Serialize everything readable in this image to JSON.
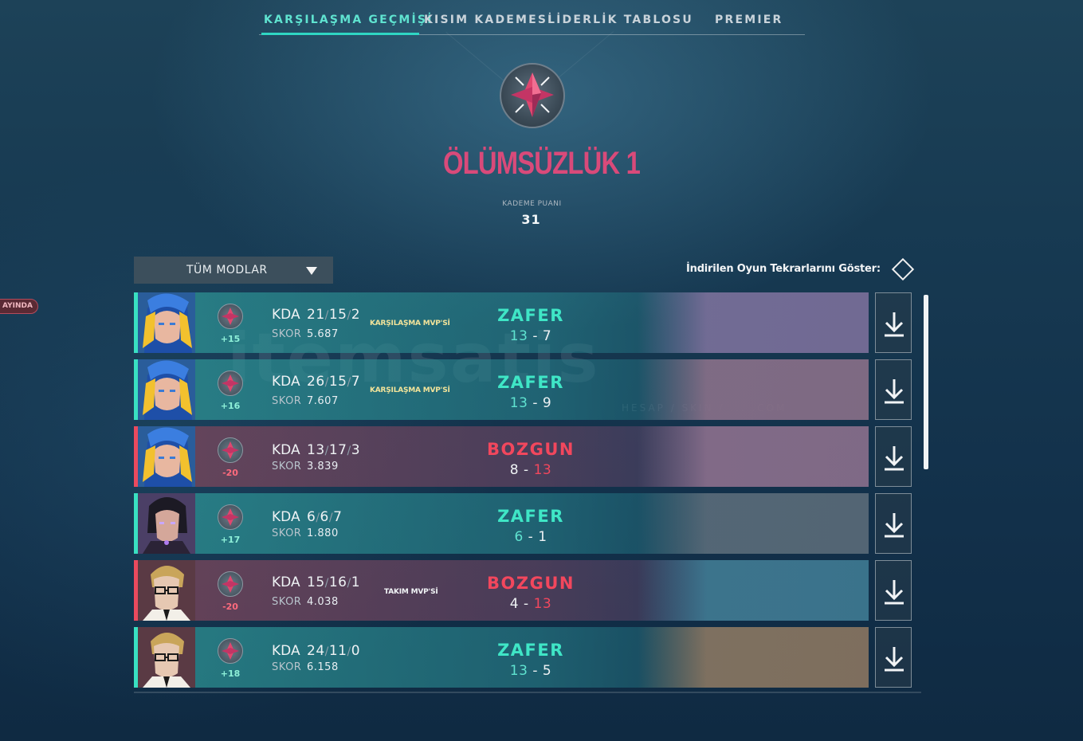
{
  "nav": {
    "tabs": [
      {
        "label": "KARŞILAŞMA GEÇMİŞİ",
        "active": true
      },
      {
        "label": "KISIM KADEMESİ",
        "active": false
      },
      {
        "label": "LİDERLİK TABLOSU",
        "active": false
      },
      {
        "label": "PREMIER",
        "active": false
      }
    ]
  },
  "rank": {
    "name": "ÖLÜMSÜZLÜK 1",
    "points_label": "KADEME PUANI",
    "points_value": "31",
    "color": "#d94a7a"
  },
  "live_badge": "AYINDA",
  "filter": {
    "mode_label": "TÜM MODLAR",
    "replay_label": "İndirilen Oyun Tekrarlarını Göster:"
  },
  "watermark": {
    "text": "itemsatis",
    "sub": "HESAP / SKIN / ... .COM"
  },
  "matches": [
    {
      "outcome": "win",
      "agent": "neon",
      "rr": "+15",
      "kda_label": "KDA",
      "kills": "21",
      "deaths": "15",
      "assists": "2",
      "score_label": "SKOR",
      "score": "5.687",
      "mvp": "KARŞILAŞMA MVP'Sİ",
      "mvp_type": "match",
      "result": "ZAFER",
      "team_score": "13",
      "enemy_score": "7",
      "map_color": "#7b6f9a"
    },
    {
      "outcome": "win",
      "agent": "neon",
      "rr": "+16",
      "kda_label": "KDA",
      "kills": "26",
      "deaths": "15",
      "assists": "7",
      "score_label": "SKOR",
      "score": "7.607",
      "mvp": "KARŞILAŞMA MVP'Sİ",
      "mvp_type": "match",
      "result": "ZAFER",
      "team_score": "13",
      "enemy_score": "9",
      "map_color": "#8a6f88"
    },
    {
      "outcome": "loss",
      "agent": "neon",
      "rr": "-20",
      "kda_label": "KDA",
      "kills": "13",
      "deaths": "17",
      "assists": "3",
      "score_label": "SKOR",
      "score": "3.839",
      "mvp": "",
      "mvp_type": "",
      "result": "BOZGUN",
      "team_score": "8",
      "enemy_score": "13",
      "map_color": "#8a6f8c"
    },
    {
      "outcome": "win",
      "agent": "reyna",
      "rr": "+17",
      "kda_label": "KDA",
      "kills": "6",
      "deaths": "6",
      "assists": "7",
      "score_label": "SKOR",
      "score": "1.880",
      "mvp": "",
      "mvp_type": "",
      "result": "ZAFER",
      "team_score": "6",
      "enemy_score": "1",
      "map_color": "#5a6a78"
    },
    {
      "outcome": "loss",
      "agent": "chamber",
      "rr": "-20",
      "kda_label": "KDA",
      "kills": "15",
      "deaths": "16",
      "assists": "1",
      "score_label": "SKOR",
      "score": "4.038",
      "mvp": "TAKIM MVP'Sİ",
      "mvp_type": "team",
      "result": "BOZGUN",
      "team_score": "4",
      "enemy_score": "13",
      "map_color": "#3e7a92"
    },
    {
      "outcome": "win",
      "agent": "chamber",
      "rr": "+18",
      "kda_label": "KDA",
      "kills": "24",
      "deaths": "11",
      "assists": "0",
      "score_label": "SKOR",
      "score": "6.158",
      "mvp": "",
      "mvp_type": "",
      "result": "ZAFER",
      "team_score": "13",
      "enemy_score": "5",
      "map_color": "#8a7560"
    }
  ]
}
